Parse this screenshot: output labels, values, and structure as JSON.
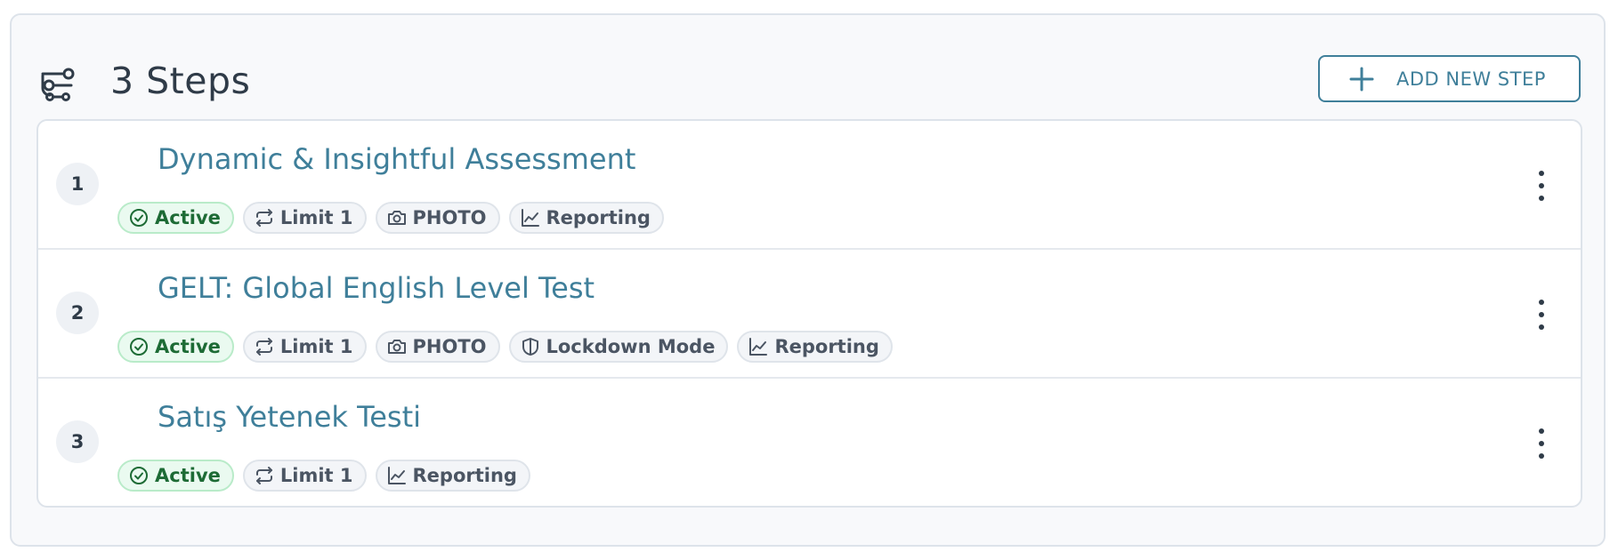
{
  "header": {
    "title": "3 Steps",
    "icon": "steps-route-icon",
    "add_button_label": "ADD NEW STEP",
    "add_button_icon": "plus-icon"
  },
  "colors": {
    "accent": "#3f7f9a",
    "active_bg": "#eafaf0",
    "active_text": "#1d6b35",
    "tag_bg": "#f3f5f8"
  },
  "steps": [
    {
      "number": "1",
      "title": "Dynamic & Insightful Assessment",
      "tags": [
        {
          "label": "Active",
          "icon": "check-circle-icon",
          "type": "active"
        },
        {
          "label": "Limit 1",
          "icon": "repeat-icon",
          "type": "default"
        },
        {
          "label": "PHOTO",
          "icon": "camera-icon",
          "type": "default"
        },
        {
          "label": "Reporting",
          "icon": "chart-line-icon",
          "type": "default"
        }
      ]
    },
    {
      "number": "2",
      "title": "GELT: Global English Level Test",
      "tags": [
        {
          "label": "Active",
          "icon": "check-circle-icon",
          "type": "active"
        },
        {
          "label": "Limit 1",
          "icon": "repeat-icon",
          "type": "default"
        },
        {
          "label": "PHOTO",
          "icon": "camera-icon",
          "type": "default"
        },
        {
          "label": "Lockdown Mode",
          "icon": "shield-icon",
          "type": "default"
        },
        {
          "label": "Reporting",
          "icon": "chart-line-icon",
          "type": "default"
        }
      ]
    },
    {
      "number": "3",
      "title": "Satış Yetenek Testi",
      "tags": [
        {
          "label": "Active",
          "icon": "check-circle-icon",
          "type": "active"
        },
        {
          "label": "Limit 1",
          "icon": "repeat-icon",
          "type": "default"
        },
        {
          "label": "Reporting",
          "icon": "chart-line-icon",
          "type": "default"
        }
      ]
    }
  ]
}
